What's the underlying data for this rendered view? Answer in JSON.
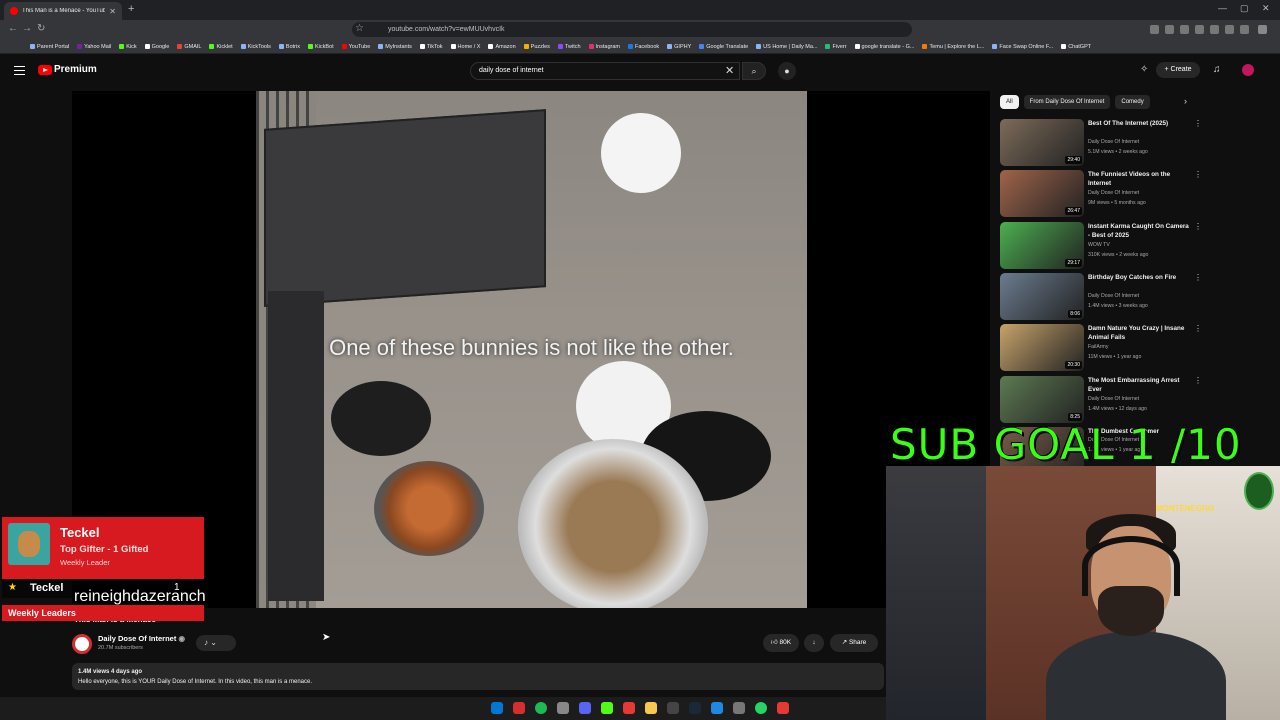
{
  "browser": {
    "tab_title": "This Man is a Menace - YouTube",
    "url": "youtube.com/watch?v=ewMUUvhvcIk",
    "bookmarks": [
      "Parent Portal",
      "Yahoo Mail",
      "Kick",
      "Google",
      "GMAIL",
      "Kicklet",
      "KickTools",
      "Botrix",
      "KickBot",
      "YouTube",
      "MyInstants",
      "TikTok",
      "Home / X",
      "Amazon",
      "Puzzles",
      "Twitch",
      "Instagram",
      "Facebook",
      "GIPHY",
      "Google Translate",
      "US Home | Daily Ma...",
      "Fiverr",
      "google translate - G...",
      "Temu | Explore the L...",
      "Face Swap Online F...",
      "ChatGPT"
    ]
  },
  "youtube": {
    "brand": "Premium",
    "search_value": "daily dose of internet",
    "create_label": "Create"
  },
  "video": {
    "caption": "One of these bunnies is not like the other.",
    "title": "This Man is a Menace",
    "channel": "Daily Dose Of Internet",
    "subscribers": "20.7M subscribers",
    "likes": "80K",
    "share_label": "Share",
    "views_age": "1.4M views  4 days ago",
    "description": "Hello everyone, this is YOUR Daily Dose of Internet. In this video, this man is a menace."
  },
  "sidebar": {
    "chips": [
      "All",
      "From Daily Dose Of Internet",
      "Comedy"
    ],
    "recommendations": [
      {
        "title": "Best Of The Internet (2025)",
        "channel": "Daily Dose Of Internet",
        "meta": "5.1M views • 2 weeks ago",
        "duration": "29:40",
        "color": "#7d6b5a"
      },
      {
        "title": "The Funniest Videos on the Internet",
        "channel": "Daily Dose Of Internet",
        "meta": "9M views • 5 months ago",
        "duration": "26:47",
        "color": "#a0644a"
      },
      {
        "title": "Instant Karma Caught On Camera - Best of 2025",
        "channel": "WOW TV",
        "meta": "310K views • 2 weeks ago",
        "duration": "29:17",
        "color": "#4caf50"
      },
      {
        "title": "Birthday Boy Catches on Fire",
        "channel": "Daily Dose Of Internet",
        "meta": "1.4M views • 3 weeks ago",
        "duration": "8:06",
        "color": "#6b7c8f"
      },
      {
        "title": "Damn Nature You Crazy | Insane Animal Fails",
        "channel": "FailArmy",
        "meta": "11M views • 1 year ago",
        "duration": "20:30",
        "color": "#c7a36b"
      },
      {
        "title": "The Most Embarrassing Arrest Ever",
        "channel": "Daily Dose Of Internet",
        "meta": "1.4M views • 12 days ago",
        "duration": "8:25",
        "color": "#5d7a52"
      },
      {
        "title": "The Dumbest Customer",
        "channel": "Daily Dose Of Internet",
        "meta": "1.1M views • 1 year ago",
        "duration": "",
        "color": "#7a5c4a"
      }
    ]
  },
  "overlay": {
    "sub_goal": "SUB GOAL 1 /10",
    "alert_name": "Teckel",
    "alert_sub": "Top Gifter - 1 Gifted",
    "alert_tag": "Weekly Leader",
    "leader_name": "Teckel",
    "leader_count": "1",
    "ranch_text": "reineighdazeranch",
    "weekly_label": "Weekly Leaders",
    "webcam_sign": "MONTENEGRO"
  }
}
